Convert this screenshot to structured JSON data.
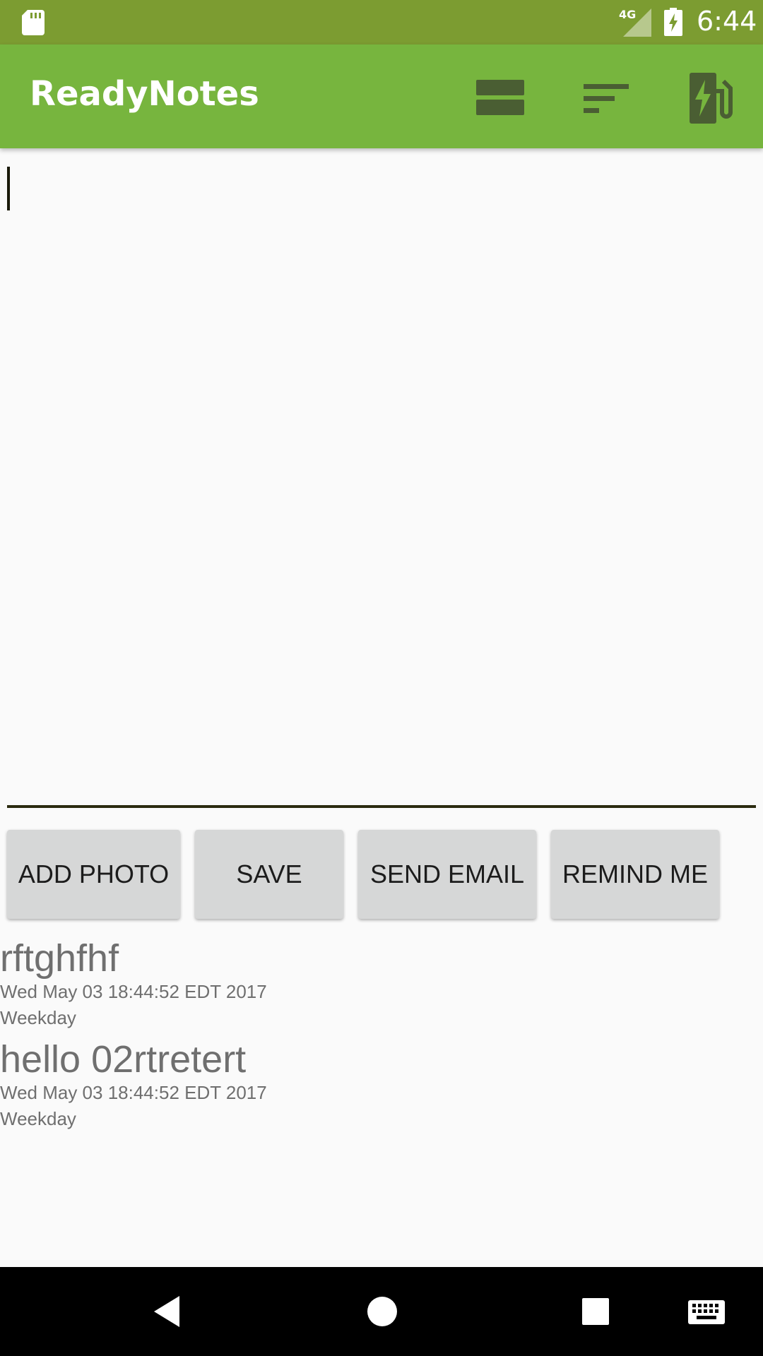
{
  "status_bar": {
    "time": "6:44",
    "network": "4G",
    "icons": [
      "sd-card-icon",
      "signal-icon",
      "battery-charging-icon"
    ]
  },
  "app_bar": {
    "title": "ReadyNotes",
    "actions": [
      "view-agenda-icon",
      "sort-icon",
      "fuel-station-icon"
    ]
  },
  "editor": {
    "value": "",
    "placeholder": ""
  },
  "buttons": {
    "add_photo": "ADD PHOTO",
    "save": "SAVE",
    "send_email": "SEND EMAIL",
    "remind_me": "REMIND ME"
  },
  "notes": [
    {
      "title": "rftghfhf",
      "date": "Wed May 03 18:44:52 EDT 2017",
      "type": "Weekday"
    },
    {
      "title": "hello 02rtretert",
      "date": "Wed May 03 18:44:52 EDT 2017",
      "type": "Weekday"
    }
  ],
  "nav_bar": {
    "icons": [
      "back-icon",
      "home-icon",
      "recents-icon",
      "keyboard-icon"
    ]
  },
  "colors": {
    "status_bar": "#7c9c31",
    "app_bar": "#77b53e",
    "app_bar_icon": "#4a5e33",
    "button_bg": "#d6d7d7",
    "note_text": "#6f6f6f"
  }
}
